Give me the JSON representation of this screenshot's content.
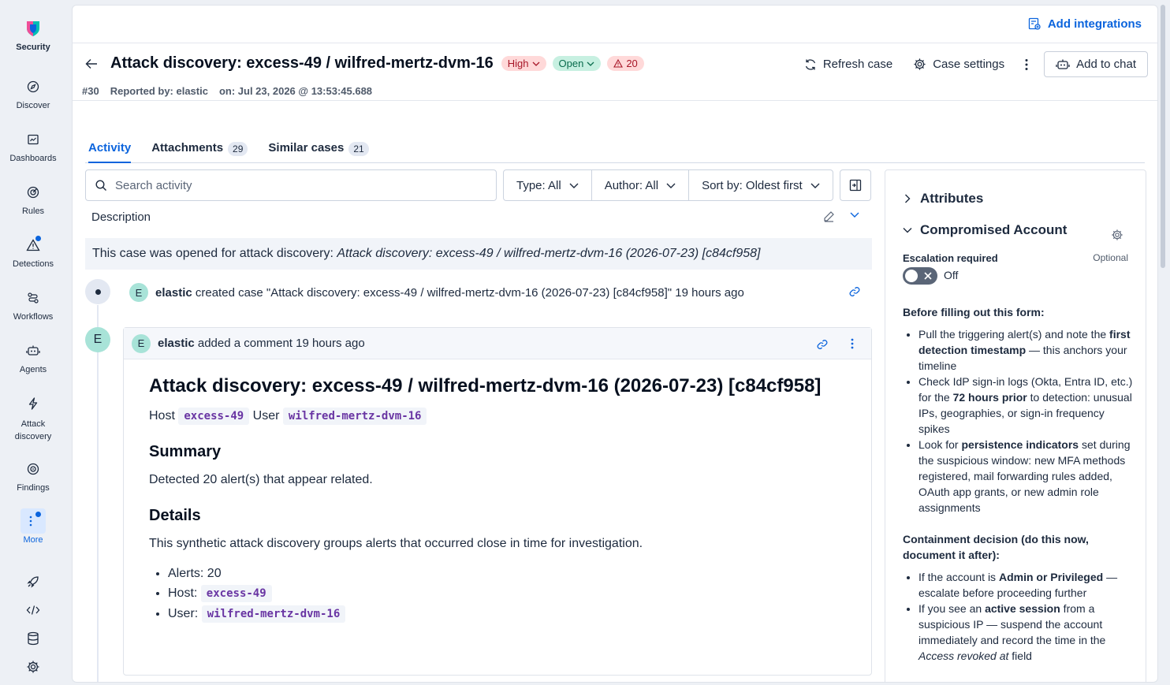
{
  "nav": {
    "brand": "Security",
    "items": [
      {
        "label": "Discover",
        "icon": "compass-icon"
      },
      {
        "label": "Dashboards",
        "icon": "dashboard-icon"
      },
      {
        "label": "Rules",
        "icon": "target-icon"
      },
      {
        "label": "Detections",
        "icon": "alert-icon"
      },
      {
        "label": "Workflows",
        "icon": "workflow-icon"
      },
      {
        "label": "Agents",
        "icon": "robot-icon"
      },
      {
        "label": "Attack",
        "label2": "discovery",
        "icon": "bolt-icon"
      },
      {
        "label": "Findings",
        "icon": "crosshair-icon"
      },
      {
        "label": "More",
        "icon": "more-icon"
      }
    ]
  },
  "topbar": {
    "add_integrations": "Add integrations"
  },
  "case": {
    "title": "Attack discovery: excess-49 / wilfred-mertz-dvm-16",
    "severity": "High",
    "status": "Open",
    "alert_count": "20",
    "number": "#30",
    "reported_by": "Reported by: elastic",
    "opened_on": "on: Jul 23, 2026 @ 13:53:45.688"
  },
  "actions": {
    "refresh": "Refresh case",
    "settings": "Case settings",
    "add_to_chat": "Add to chat"
  },
  "tabs": [
    {
      "label": "Activity"
    },
    {
      "label": "Attachments",
      "count": "29"
    },
    {
      "label": "Similar cases",
      "count": "21"
    }
  ],
  "search": {
    "placeholder": "Search activity"
  },
  "filters": {
    "type": "Type: All",
    "author": "Author: All",
    "sort": "Sort by: Oldest first"
  },
  "description": {
    "label": "Description",
    "prefix": "This case was opened for attack discovery: ",
    "italic": "Attack discovery: excess-49 / wilfred-mertz-dvm-16 (2026-07-23) [c84cf958]"
  },
  "activity": {
    "created": {
      "avatar": "E",
      "user": "elastic",
      "text": "created case \"Attack discovery: excess-49 / wilfred-mertz-dvm-16 (2026-07-23) [c84cf958]\" 19 hours ago"
    },
    "comment": {
      "avatar": "E",
      "user": "elastic",
      "text": "added a comment 19 hours ago",
      "heading": "Attack discovery: excess-49 / wilfred-mertz-dvm-16 (2026-07-23) [c84cf958]",
      "host_label": "Host",
      "host": "excess-49",
      "user_label": "User",
      "user_value": "wilfred-mertz-dvm-16",
      "summary_heading": "Summary",
      "summary_text": "Detected 20 alert(s) that appear related.",
      "details_heading": "Details",
      "details_text": "This synthetic attack discovery groups alerts that occurred close in time for investigation.",
      "list": {
        "alerts": "Alerts: 20",
        "host_label": "Host:",
        "host": "excess-49",
        "user_label": "User:",
        "user": "wilfred-mertz-dvm-16"
      }
    }
  },
  "sidebar": {
    "attributes": "Attributes",
    "template": "Compromised Account",
    "escalation_label": "Escalation required",
    "optional": "Optional",
    "toggle_state": "Off",
    "before_heading": "Before filling out this form:",
    "before_items": [
      [
        "Pull the triggering alert(s) and note the ",
        "first detection timestamp",
        " — this anchors your timeline"
      ],
      [
        "Check IdP sign-in logs (Okta, Entra ID, etc.) for the ",
        "72 hours prior",
        " to detection: unusual IPs, geographies, or sign-in frequency spikes"
      ],
      [
        "Look for ",
        "persistence indicators",
        " set during the suspicious window: new MFA methods registered, mail forwarding rules added, OAuth app grants, or new admin role assignments"
      ]
    ],
    "containment_heading": "Containment decision (do this now, document it after):",
    "containment_items": [
      [
        "If the account is ",
        "Admin or Privileged",
        " — escalate before proceeding further"
      ],
      [
        "If you see an ",
        "active session",
        " from a suspicious IP — suspend the account immediately and record the time in the "
      ]
    ],
    "containment_field": "Access revoked at",
    "containment_tail": " field"
  }
}
